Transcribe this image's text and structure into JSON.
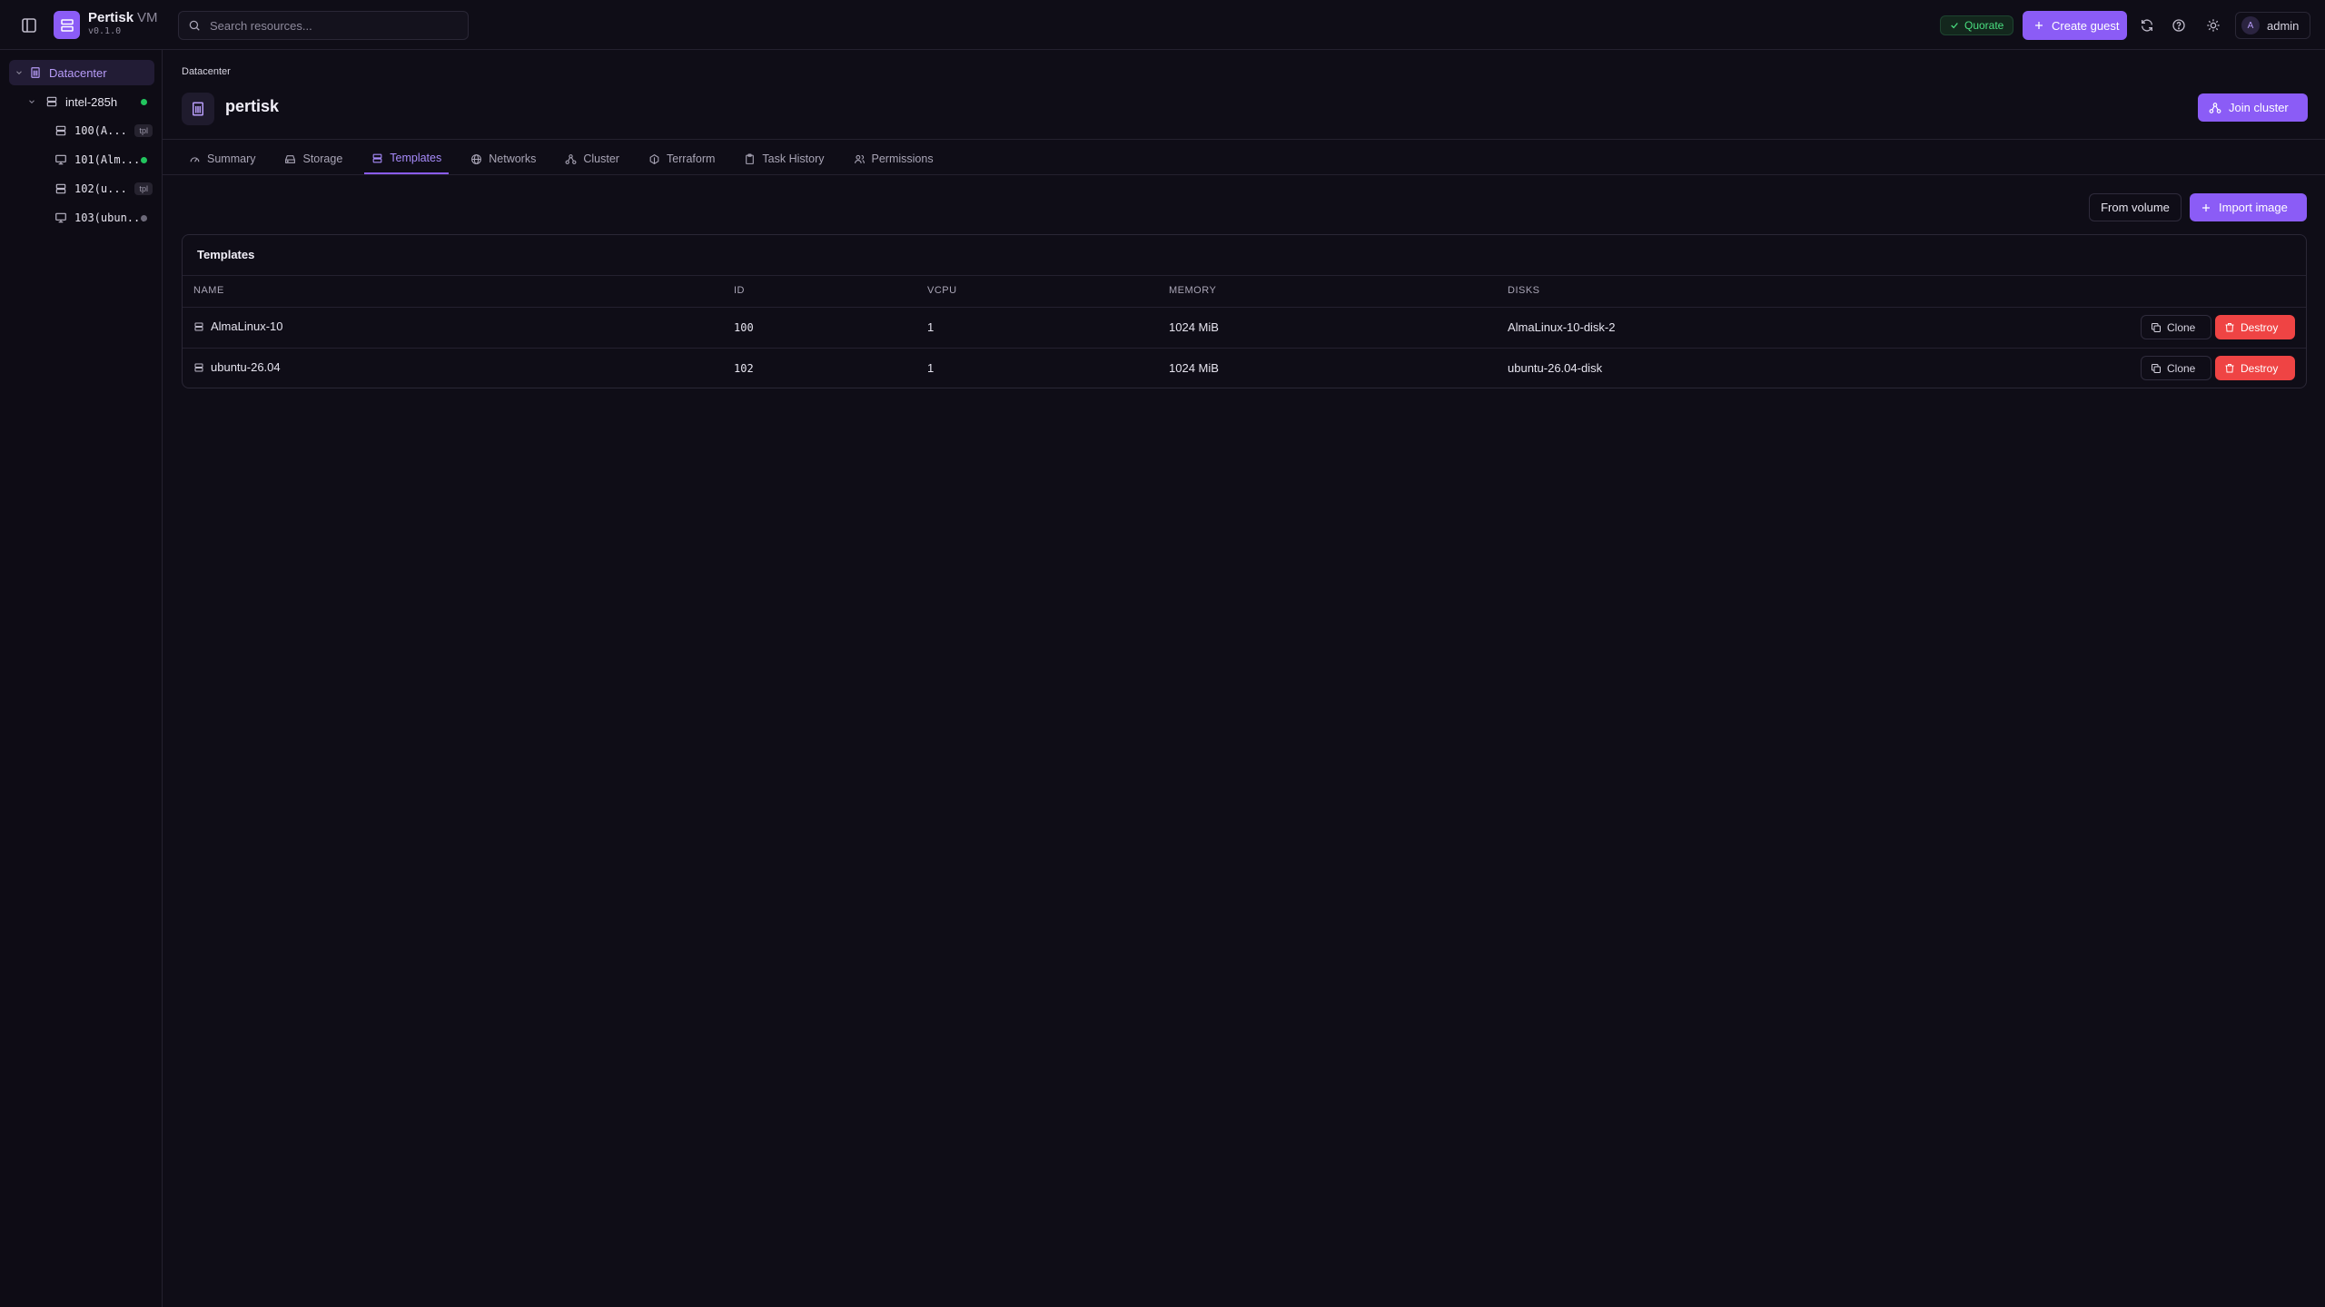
{
  "app": {
    "name": "Pertisk",
    "suffix": "VM",
    "version": "v0.1.0"
  },
  "search": {
    "placeholder": "Search resources..."
  },
  "header": {
    "quorate_label": "Quorate",
    "create_guest_label": "Create guest",
    "user_initial": "A",
    "user_name": "admin"
  },
  "sidebar": {
    "datacenter_label": "Datacenter",
    "node": {
      "label": "intel-285h",
      "status": "online"
    },
    "items": [
      {
        "label": "100(A...",
        "kind": "template",
        "tag": "tpl"
      },
      {
        "label": "101(Alm...",
        "kind": "vm",
        "status": "running"
      },
      {
        "label": "102(u...",
        "kind": "template",
        "tag": "tpl"
      },
      {
        "label": "103(ubun...",
        "kind": "vm",
        "status": "stopped"
      }
    ]
  },
  "page": {
    "breadcrumb": "Datacenter",
    "title": "pertisk",
    "join_cluster_label": "Join cluster"
  },
  "tabs": [
    {
      "label": "Summary",
      "icon": "gauge-icon"
    },
    {
      "label": "Storage",
      "icon": "hard-drive-icon"
    },
    {
      "label": "Templates",
      "icon": "template-icon",
      "active": true
    },
    {
      "label": "Networks",
      "icon": "globe-icon"
    },
    {
      "label": "Cluster",
      "icon": "cluster-icon"
    },
    {
      "label": "Terraform",
      "icon": "terraform-icon"
    },
    {
      "label": "Task History",
      "icon": "clipboard-icon"
    },
    {
      "label": "Permissions",
      "icon": "users-icon"
    }
  ],
  "actions": {
    "from_volume_label": "From volume",
    "import_image_label": "Import image"
  },
  "templates": {
    "card_title": "Templates",
    "columns": [
      "NAME",
      "ID",
      "VCPU",
      "MEMORY",
      "DISKS"
    ],
    "rows": [
      {
        "name": "AlmaLinux-10",
        "id": "100",
        "vcpu": "1",
        "memory": "1024 MiB",
        "disks": "AlmaLinux-10-disk-2"
      },
      {
        "name": "ubuntu-26.04",
        "id": "102",
        "vcpu": "1",
        "memory": "1024 MiB",
        "disks": "ubuntu-26.04-disk"
      }
    ],
    "clone_label": "Clone",
    "destroy_label": "Destroy"
  },
  "colors": {
    "accent": "#8b5cf6",
    "danger": "#ef4444",
    "success": "#22c55e",
    "background": "#0f0d17"
  }
}
